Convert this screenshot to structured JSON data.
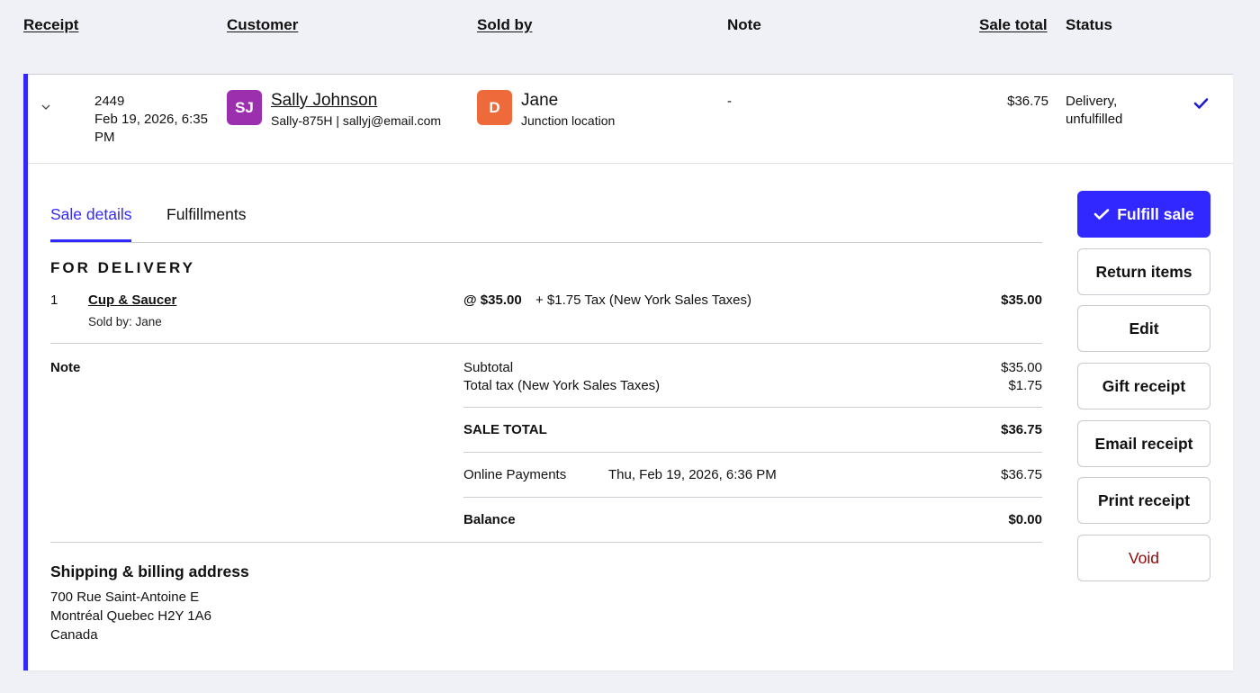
{
  "table_header": {
    "receipt": "Receipt",
    "customer": "Customer",
    "sold_by": "Sold by",
    "note": "Note",
    "sale_total": "Sale total",
    "status": "Status"
  },
  "row": {
    "receipt_number": "2449",
    "date_line1": "Feb 19, 2026, 6:35",
    "date_line2": "PM",
    "customer": {
      "initials": "SJ",
      "avatar_color": "#9b2fae",
      "name": "Sally Johnson",
      "meta": "Sally-875H | sallyj@email.com"
    },
    "seller": {
      "initial": "D",
      "avatar_color": "#ef6a3a",
      "name": "Jane",
      "location": "Junction location"
    },
    "note": "-",
    "sale_total": "$36.75",
    "status_line1": "Delivery,",
    "status_line2": "unfulfilled",
    "status_icon": "check-icon"
  },
  "tabs": [
    {
      "label": "Sale details",
      "active": true
    },
    {
      "label": "Fulfillments",
      "active": false
    }
  ],
  "details": {
    "section_title": "FOR DELIVERY",
    "item": {
      "qty": "1",
      "name": "Cup & Saucer",
      "sold_by": "Sold by: Jane",
      "unit_price": "@ $35.00",
      "tax": "+ $1.75 Tax (New York Sales Taxes)",
      "line_total": "$35.00"
    },
    "note_label": "Note",
    "subtotal_label": "Subtotal",
    "subtotal_value": "$35.00",
    "tax_label": "Total tax (New York Sales Taxes)",
    "tax_value": "$1.75",
    "sale_total_label": "SALE TOTAL",
    "sale_total_value": "$36.75",
    "payment_label": "Online Payments",
    "payment_date": "Thu, Feb 19, 2026, 6:36 PM",
    "payment_value": "$36.75",
    "balance_label": "Balance",
    "balance_value": "$0.00",
    "address_title": "Shipping & billing address",
    "address_line1": "700 Rue Saint-Antoine E",
    "address_line2": "Montréal Quebec H2Y 1A6",
    "address_line3": "Canada"
  },
  "actions": {
    "fulfill": "Fulfill sale",
    "return_items": "Return items",
    "edit": "Edit",
    "gift_receipt": "Gift receipt",
    "email_receipt": "Email receipt",
    "print_receipt": "Print receipt",
    "void": "Void"
  },
  "colors": {
    "accent": "#3127ff",
    "danger": "#8c0a0a"
  }
}
